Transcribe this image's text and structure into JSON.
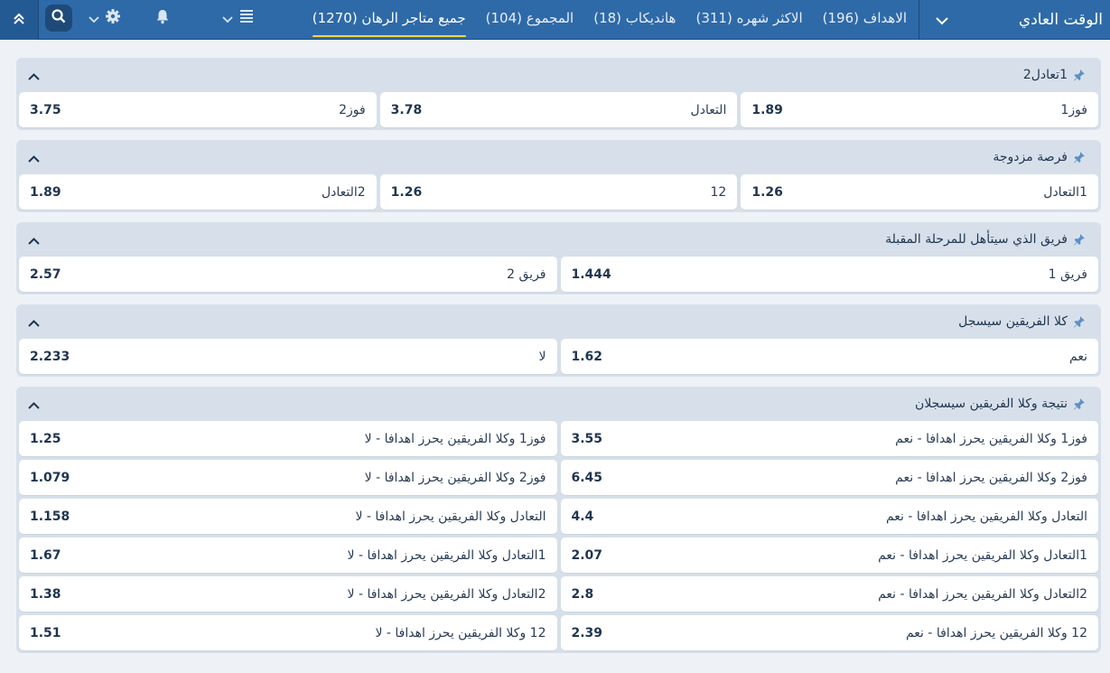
{
  "header": {
    "period_label": "الوقت العادي",
    "tabs": [
      {
        "label": "جميع متاجر الرهان (1270)",
        "active": true
      },
      {
        "label": "المجموع (104)",
        "active": false
      },
      {
        "label": "هانديكاب (18)",
        "active": false
      },
      {
        "label": "الاكثر شهره (311)",
        "active": false
      },
      {
        "label": "الاهداف (196)",
        "active": false
      }
    ],
    "icons": [
      "collapse-icon",
      "search-icon",
      "settings-icon",
      "bell-icon",
      "list-icon",
      "chevron-down-icon"
    ]
  },
  "markets": [
    {
      "title": "1تعادل2",
      "columns": 3,
      "outcomes": [
        {
          "label": "فوز1",
          "odd": "1.89"
        },
        {
          "label": "التعادل",
          "odd": "3.78"
        },
        {
          "label": "فوز2",
          "odd": "3.75"
        }
      ]
    },
    {
      "title": "فرصة مزدوجة",
      "columns": 3,
      "outcomes": [
        {
          "label": "1التعادل",
          "odd": "1.26"
        },
        {
          "label": "12",
          "odd": "1.26"
        },
        {
          "label": "2التعادل",
          "odd": "1.89"
        }
      ]
    },
    {
      "title": "فريق الذي سيتأهل للمرحلة المقبلة",
      "columns": 2,
      "outcomes": [
        {
          "label": "فريق 1",
          "odd": "1.444"
        },
        {
          "label": "فريق 2",
          "odd": "2.57"
        }
      ]
    },
    {
      "title": "كلا الفريقين سيسجل",
      "columns": 2,
      "outcomes": [
        {
          "label": "نعم",
          "odd": "1.62"
        },
        {
          "label": "لا",
          "odd": "2.233"
        }
      ]
    },
    {
      "title": "نتيجة وكلا الفريقين سيسجلان",
      "columns": 2,
      "outcomes": [
        {
          "label": "فوز1 وكلا الفريقين يحرز اهدافا - نعم",
          "odd": "3.55"
        },
        {
          "label": "فوز1 وكلا الفريقين يحرز اهدافا - لا",
          "odd": "1.25"
        },
        {
          "label": "فوز2 وكلا الفريقين يحرز اهدافا - نعم",
          "odd": "6.45"
        },
        {
          "label": "فوز2 وكلا الفريقين يحرز اهدافا - لا",
          "odd": "1.079"
        },
        {
          "label": "التعادل وكلا الفريقين يحرز اهدافا - نعم",
          "odd": "4.4"
        },
        {
          "label": "التعادل وكلا الفريقين يحرز اهدافا - لا",
          "odd": "1.158"
        },
        {
          "label": "1التعادل وكلا الفريقين يحرز اهدافا - نعم",
          "odd": "2.07"
        },
        {
          "label": "1التعادل وكلا الفريقين يحرز اهدافا - لا",
          "odd": "1.67"
        },
        {
          "label": "2التعادل وكلا الفريقين يحرز اهدافا - نعم",
          "odd": "2.8"
        },
        {
          "label": "2التعادل وكلا الفريقين يحرز اهدافا - لا",
          "odd": "1.38"
        },
        {
          "label": "12 وكلا الفريقين يحرز اهدافا - نعم",
          "odd": "2.39"
        },
        {
          "label": "12 وكلا الفريقين يحرز اهدافا - لا",
          "odd": "1.51"
        }
      ]
    }
  ],
  "colors": {
    "header_bg": "#2e6aa8",
    "accent_underline": "#f3d44a",
    "market_bg": "#d7e0ea",
    "page_bg": "#eef2f7"
  }
}
